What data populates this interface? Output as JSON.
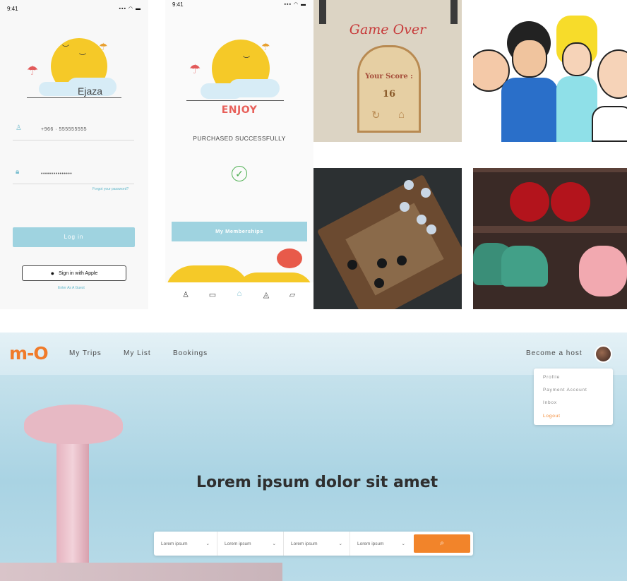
{
  "phone_login": {
    "time": "9:41",
    "status_icons": "▪▪▪ ◠ ▬",
    "brand": "Ejaza",
    "phone_value": "+966 · 555555555",
    "password_value": "•••••••••••••••",
    "forgot_label": "Forgot your password?",
    "login_label": "Log in",
    "apple_label": "Sign in with Apple",
    "guest_label": "Enter As A Guest"
  },
  "phone_success": {
    "time": "9:41",
    "status_icons": "▪▪▪ ◠ ▬",
    "enjoy_label": "ENJOY",
    "message": "PURCHASED SUCCESSFULLY",
    "memberships_label": "My Memberships",
    "nav_icons": [
      "user-icon",
      "chat-icon",
      "home-icon",
      "bell-icon",
      "ticket-icon"
    ]
  },
  "game_over": {
    "title": "Game Over",
    "score_label": "Your Score :",
    "score_value": "16"
  },
  "website": {
    "logo_text": "m-O",
    "nav": [
      "My Trips",
      "My List",
      "Bookings"
    ],
    "become_host": "Become a host",
    "menu": [
      "Profile",
      "Payment Account",
      "Inbox",
      "Logout"
    ],
    "hero_title": "Lorem ipsum dolor sit amet",
    "search_fields": [
      "Lorem ipsum",
      "Lorem ipsum",
      "Lorem ipsum",
      "Lorem ipsum"
    ],
    "accent": "#f2842a"
  }
}
